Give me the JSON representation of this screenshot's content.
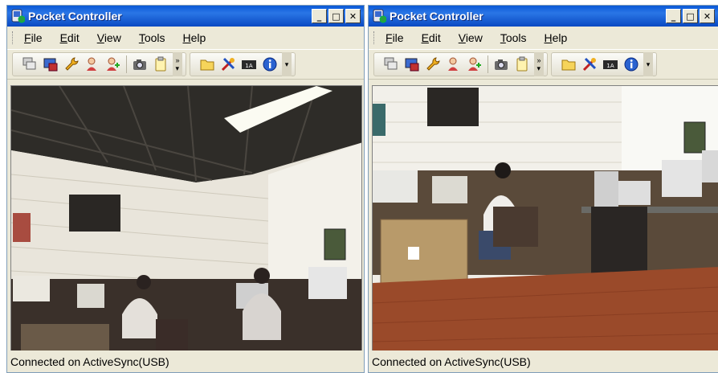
{
  "windows": [
    {
      "title": "Pocket Controller",
      "window_buttons": [
        "_",
        "□",
        "✕"
      ],
      "menu": [
        "File",
        "Edit",
        "View",
        "Tools",
        "Help"
      ],
      "toolbar": {
        "group1": [
          "multi-window-icon",
          "desktop-icon",
          "wrench-icon",
          "user-icon",
          "user-add-icon",
          "camera-icon",
          "clipboard-icon"
        ],
        "group2": [
          "folder-icon",
          "tools-icon",
          "keyboard-icon",
          "info-icon"
        ]
      },
      "status": "Connected on ActiveSync(USB)"
    },
    {
      "title": "Pocket Controller",
      "window_buttons": [
        "_",
        "□",
        "✕"
      ],
      "menu": [
        "File",
        "Edit",
        "View",
        "Tools",
        "Help"
      ],
      "toolbar": {
        "group1": [
          "multi-window-icon",
          "desktop-icon",
          "wrench-icon",
          "user-icon",
          "user-add-icon",
          "camera-icon",
          "clipboard-icon"
        ],
        "group2": [
          "folder-icon",
          "tools-icon",
          "keyboard-icon",
          "info-icon"
        ]
      },
      "status": "Connected on ActiveSync(USB)"
    }
  ],
  "colors": {
    "titlebar": "#0a58d6",
    "window_face": "#ece9d8",
    "floor": "#9a4a2a",
    "wall": "#e6e2d8"
  }
}
